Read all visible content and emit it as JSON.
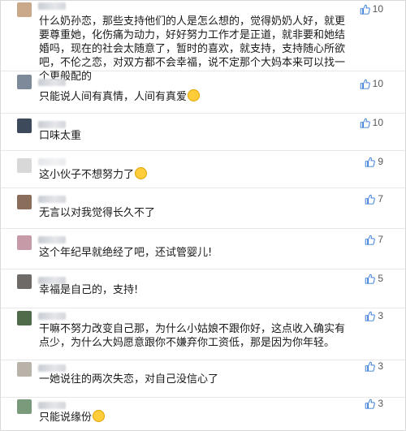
{
  "comments": [
    {
      "text": "什么奶孙恋，那些支持他们的人是怎么想的，觉得奶奶人好，就更要尊重她，化伤痛为动力，好好努力工作才是正道，就非要和她结婚吗，现在的社会太随意了，暂时的喜欢，就支持，支持随心所欲吧，不伦之恋，对双方都不会幸福，说不定那个大妈本来可以找一个更般配的",
      "likes": "10",
      "avatar_color": "#c9a98a",
      "emoji": ""
    },
    {
      "text": "只能说人间有真情，人间有真爱",
      "likes": "10",
      "avatar_color": "#7c8a99",
      "emoji": "face-emoji"
    },
    {
      "text": "口味太重",
      "likes": "10",
      "avatar_color": "#3d4a5c",
      "emoji": ""
    },
    {
      "text": "这小伙子不想努力了",
      "likes": "9",
      "avatar_color": "#d8d8d8",
      "emoji": "face-emoji"
    },
    {
      "text": "无言以对我觉得长久不了",
      "likes": "7",
      "avatar_color": "#8a6d5a",
      "emoji": ""
    },
    {
      "text": "这个年纪早就绝经了吧，还试管婴儿!",
      "likes": "7",
      "avatar_color": "#c79aa8",
      "emoji": ""
    },
    {
      "text": "幸福是自己的，支持!",
      "likes": "5",
      "avatar_color": "#6d6a67",
      "emoji": ""
    },
    {
      "text": "干嘛不努力改变自己那，为什么小姑娘不跟你好，这点收入确实有点少，为什么大妈愿意跟你不嫌弃你工资低，那是因为你年轻。",
      "likes": "3",
      "avatar_color": "#4f6b4a",
      "emoji": ""
    },
    {
      "text": "一她说往的两次失恋，对自己没信心了",
      "likes": "3",
      "avatar_color": "#b9b2a8",
      "emoji": ""
    },
    {
      "text": "只能说缘份",
      "likes": "3",
      "avatar_color": "#7a9a7c",
      "emoji": "face-emoji"
    }
  ],
  "colors": {
    "like_icon": "#3b7dd8",
    "divider": "#e8e8e8"
  },
  "icons": {
    "like": "thumbs-up-icon",
    "emoji": "face-emoji"
  }
}
